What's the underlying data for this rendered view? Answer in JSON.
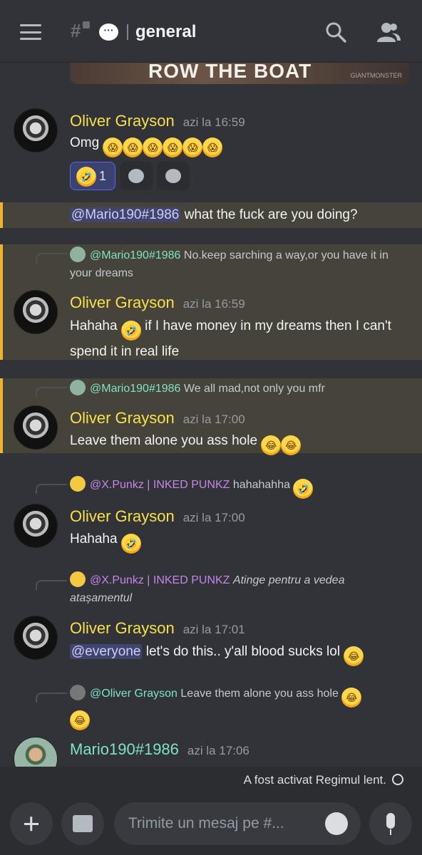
{
  "header": {
    "channel": "general",
    "hash": "#"
  },
  "banner": {
    "text": "ROW THE BOAT",
    "watermark": "GIANTMONSTER"
  },
  "messages": {
    "m1": {
      "author": "Oliver Grayson",
      "time": "azi la 16:59",
      "text": "Omg",
      "reaction_count": "1"
    },
    "m2": {
      "mention": "@Mario190#1986",
      "text": "what the fuck are you doing?"
    },
    "m3": {
      "reply_user": "@Mario190#1986",
      "reply_text": "No.keep sarching a way,or you have it in your dreams",
      "author": "Oliver Grayson",
      "time": "azi la 16:59",
      "text_a": "Hahaha",
      "text_b": "if I have money in my dreams then I can't spend it in real life"
    },
    "m4": {
      "reply_user": "@Mario190#1986",
      "reply_text": "We all mad,not only you mfr",
      "author": "Oliver Grayson",
      "time": "azi la 17:00",
      "text": "Leave them alone you ass hole"
    },
    "m5": {
      "reply_user": "@X.Punkz | INKED PUNKZ",
      "reply_text": "hahahahha",
      "author": "Oliver Grayson",
      "time": "azi la 17:00",
      "text": "Hahaha"
    },
    "m6": {
      "reply_user": "@X.Punkz | INKED PUNKZ",
      "reply_text": "Atinge pentru a vedea atașamentul",
      "author": "Oliver Grayson",
      "time": "azi la 17:01",
      "mention": "@everyone",
      "text": "let's do this.. y'all blood sucks lol"
    },
    "m7": {
      "reply_user": "@Oliver Grayson",
      "reply_text": "Leave them alone you ass hole",
      "author": "Mario190#1986",
      "time": "azi la 17:06"
    }
  },
  "slowmode": {
    "text": "A fost activat Regimul lent."
  },
  "composer": {
    "placeholder": "Trimite un mesaj pe #..."
  },
  "colors": {
    "background": "#313338",
    "highlight": "#46443a",
    "highlight_bar": "#f0b232",
    "author_oliver": "#f7e04b",
    "author_mario": "#7ee3c4",
    "mention_bg": "#41456c",
    "punk_name": "#c685e8"
  }
}
